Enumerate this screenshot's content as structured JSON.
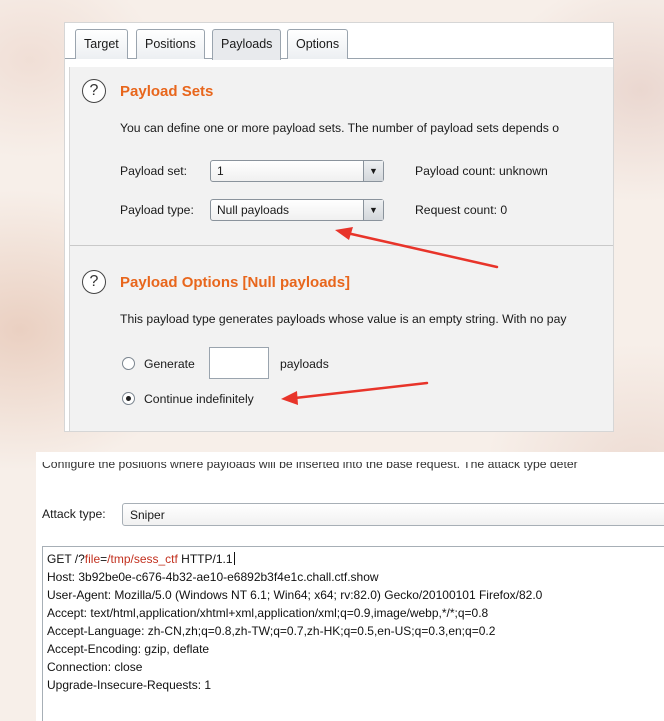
{
  "tabs": [
    {
      "label": "Target"
    },
    {
      "label": "Positions"
    },
    {
      "label": "Payloads"
    },
    {
      "label": "Options"
    }
  ],
  "payload_sets": {
    "help": "?",
    "title": "Payload Sets",
    "description": "You can define one or more payload sets. The number of payload sets depends o",
    "set_label": "Payload set:",
    "set_value": "1",
    "type_label": "Payload type:",
    "type_value": "Null payloads",
    "count_label": "Payload count:",
    "count_value": "unknown",
    "request_label": "Request count:",
    "request_value": "0"
  },
  "payload_options": {
    "help": "?",
    "title": "Payload Options [Null payloads]",
    "description": "This payload type generates payloads whose value is an empty string. With no pay",
    "generate_label": "Generate",
    "generate_value": "",
    "payloads_label": "payloads",
    "continue_label": "Continue indefinitely",
    "selected": "continue"
  },
  "positions": {
    "intro": "Configure the positions where payloads will be inserted into the base request. The attack type deter",
    "attack_label": "Attack type:",
    "attack_value": "Sniper",
    "request_first": {
      "pre": "GET /?",
      "param": "file",
      "eq": "=",
      "value": "/tmp/sess_ctf",
      "post": " HTTP/1.1"
    },
    "request_lines": [
      "Host: 3b92be0e-c676-4b32-ae10-e6892b3f4e1c.chall.ctf.show",
      "User-Agent: Mozilla/5.0 (Windows NT 6.1; Win64; x64; rv:82.0) Gecko/20100101 Firefox/82.0",
      "Accept: text/html,application/xhtml+xml,application/xml;q=0.9,image/webp,*/*;q=0.8",
      "Accept-Language: zh-CN,zh;q=0.8,zh-TW;q=0.7,zh-HK;q=0.5,en-US;q=0.3,en;q=0.2",
      "Accept-Encoding: gzip, deflate",
      "Connection: close",
      "Upgrade-Insecure-Requests: 1"
    ]
  },
  "colors": {
    "accent": "#e8661c",
    "annotation_arrow": "#e8342a",
    "param_highlight": "#c2301e"
  },
  "icons": [
    "help-icon",
    "chevron-down-icon",
    "radio-icon",
    "annotation-arrow"
  ]
}
